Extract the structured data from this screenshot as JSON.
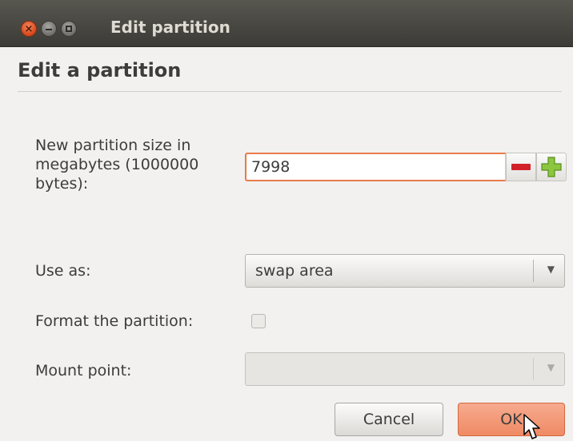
{
  "window": {
    "title": "Edit partition",
    "buttons": [
      "close-icon",
      "minimize-icon",
      "maximize-icon"
    ],
    "colors": {
      "titlebar": "#3c3b37",
      "accent": "#e87a4a",
      "close": "#df4a1a"
    }
  },
  "dialog": {
    "heading": "Edit a partition",
    "size": {
      "label": "New partition size in megabytes (1000000 bytes):",
      "value": "7998"
    },
    "use_as": {
      "label": "Use as:",
      "value": "swap area"
    },
    "format": {
      "label": "Format the partition:",
      "checked": false
    },
    "mount": {
      "label": "Mount point:",
      "value": ""
    },
    "buttons": {
      "cancel": "Cancel",
      "ok": "OK"
    }
  }
}
